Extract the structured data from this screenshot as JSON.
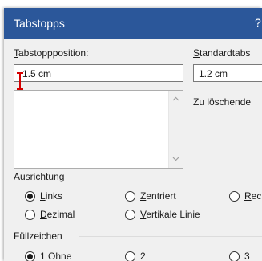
{
  "dialog": {
    "title": "Tabstopps",
    "help_label": "?"
  },
  "tabstop_position": {
    "label_first": "T",
    "label_rest": "abstoppposition:",
    "value": "1.5 cm",
    "list_items": []
  },
  "default_tabs": {
    "label_first": "S",
    "label_rest": "tandardtabs",
    "value": "1.2 cm"
  },
  "to_clear_label": "Zu löschende",
  "alignment": {
    "group_label": "Ausrichtung",
    "options": [
      {
        "first": "L",
        "rest": "inks",
        "checked": true
      },
      {
        "first": "Z",
        "rest": "entriert",
        "checked": false
      },
      {
        "first": "R",
        "rest": "ec",
        "checked": false
      },
      {
        "first": "D",
        "rest": "ezimal",
        "checked": false
      },
      {
        "first": "V",
        "rest": "ertikale Linie",
        "checked": false
      }
    ]
  },
  "leader": {
    "group_label": "Füllzeichen",
    "options": [
      {
        "label": "1 Ohne",
        "checked": true
      },
      {
        "label": "2 ",
        "checked": false
      },
      {
        "label": "3 ",
        "checked": false
      }
    ]
  },
  "colors": {
    "titlebar": "#2b579a",
    "cursor": "#d40000"
  }
}
